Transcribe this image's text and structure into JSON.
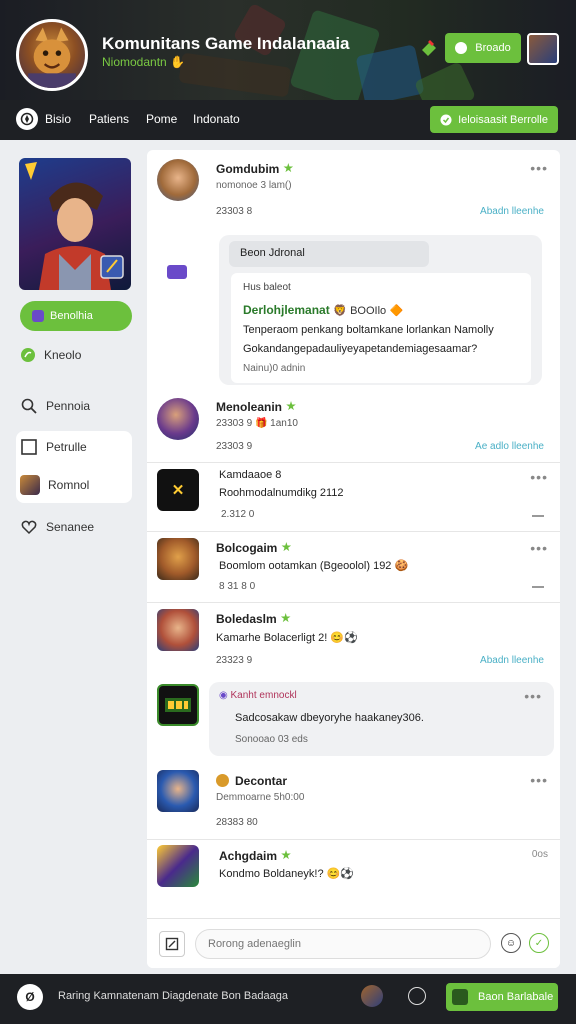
{
  "header": {
    "title": "Komunitans Game Indalanaaia",
    "subtitle": "Niomodantn",
    "action_label": "Broado"
  },
  "nav": {
    "items": [
      "Bisio",
      "Patiens",
      "Pome",
      "Indonato"
    ],
    "cta_label": "Ieloisaasit Berrolle"
  },
  "sidebar": {
    "primary_button": "Benolhia",
    "items": [
      "Kneolo",
      "Pennoia",
      "Petrulle",
      "Romnol",
      "Senanee"
    ]
  },
  "feed": {
    "posts": [
      {
        "name": "Gomdubim",
        "meta": "nomonoe 3 lam()",
        "time": "23303 8",
        "reply_link": "Abadn lleenhe",
        "reply": {
          "title": "Beon Jdronal",
          "label": "Hus baleot",
          "heading": "Derlohjlemanat",
          "heading_tail": "BOOIlo",
          "line1": "Tenperaom penkang boltamkane lorlankan Namolly",
          "line2": "Gokandangepadauliyeyapetandemiagesaamar?",
          "time": "Nainu)0 adnin"
        }
      },
      {
        "name": "Menoleanin",
        "time": "23303 9",
        "meta": "1an10",
        "reply_link": "Ae adlo lleenhe"
      },
      {
        "name": "Kamdaaoe 8",
        "text": "Roohmodalnumdikg 2112",
        "time": "2.312 0"
      },
      {
        "name": "Bolcogaim",
        "text": "Boomlom ootamkan (Bgeoolol) 192",
        "time": "8 31 8 0"
      },
      {
        "name": "Boledaslm",
        "text": "Kamarhe Bolacerligt 2!",
        "time": "23323 9",
        "reply_link": "Abadn lleenhe"
      },
      {
        "reply_tag": "Kanht emnockl",
        "text": "Sadcosakaw dbeyoryhe haakaney306.",
        "sub": "Sonooao 03 eds"
      },
      {
        "name": "Decontar",
        "meta": "Demmoarne 5h0:00",
        "time": "28383 80"
      },
      {
        "name": "Achgdaim",
        "text": "Kondmo Boldaneyk!?",
        "more": "0os"
      }
    ]
  },
  "composer": {
    "placeholder": "Rorong adenaeglin"
  },
  "footer": {
    "text": "Raring Kamnatenam Diagdenate Bon Badaaga",
    "button_label": "Baon Barlabale"
  },
  "colors": {
    "accent": "#6cc03d",
    "dark_bar": "#1e2024",
    "link": "#4ab0c6"
  }
}
